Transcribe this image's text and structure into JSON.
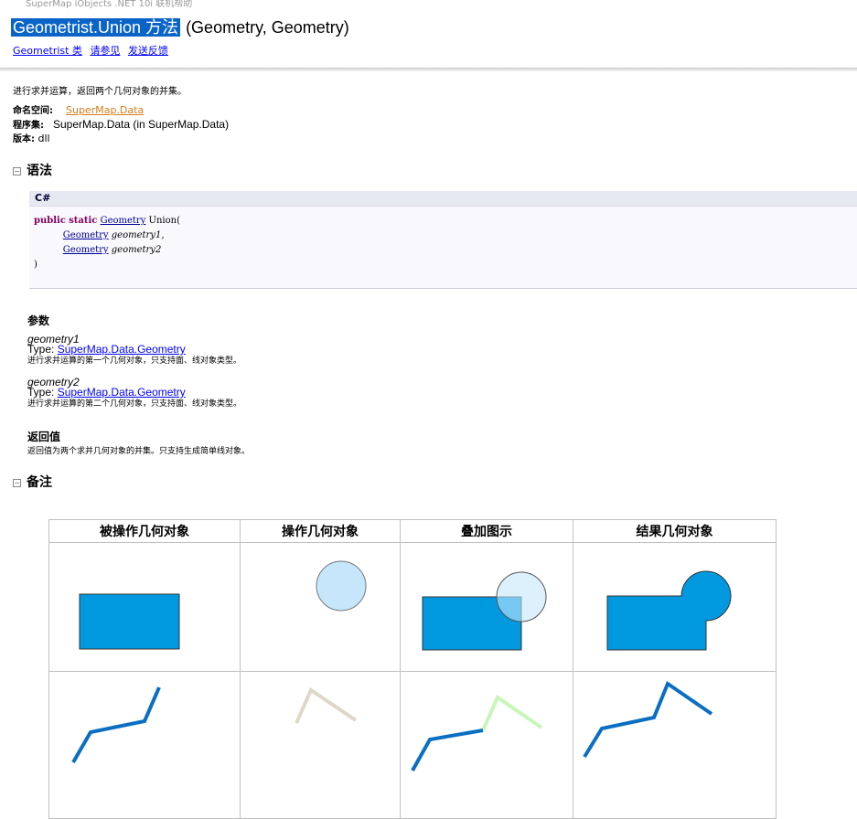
{
  "header": {
    "product": "SuperMap iObjects .NET 10i 联机帮助",
    "title_highlight": "Geometrist.Union 方法",
    "title_rest": "(Geometry, Geometry)",
    "links": [
      "Geometrist 类",
      "请参见",
      "发送反馈"
    ]
  },
  "summary": "进行求并运算，返回两个几何对象的并集。",
  "meta": {
    "namespace_label": "命名空间:",
    "namespace_value": "SuperMap.Data",
    "assembly_label": "程序集:",
    "assembly_value": "SuperMap.Data (in SuperMap.Data)",
    "version_label": "版本:",
    "version_value": "dll"
  },
  "sections": {
    "syntax": "语法",
    "remarks": "备注",
    "collapse_glyph": "−"
  },
  "code": {
    "lang": "C#",
    "kw1": "public",
    "kw2": "static",
    "ret_type": "Geometry",
    "method": "Union(",
    "p1_type": "Geometry",
    "p1_name": "geometry1,",
    "p2_type": "Geometry",
    "p2_name": "geometry2",
    "close": ")"
  },
  "params": {
    "heading": "参数",
    "items": [
      {
        "name": "geometry1",
        "type_label": "Type:",
        "type_link": "SuperMap.Data.Geometry",
        "desc": "进行求并运算的第一个几何对象，只支持面、线对象类型。"
      },
      {
        "name": "geometry2",
        "type_label": "Type:",
        "type_link": "SuperMap.Data.Geometry",
        "desc": "进行求并运算的第二个几何对象，只支持面、线对象类型。"
      }
    ]
  },
  "returns": {
    "heading": "返回值",
    "desc": "返回值为两个求并几何对象的并集。只支持生成简单线对象。"
  },
  "table": {
    "headers": [
      "被操作几何对象",
      "操作几何对象",
      "叠加图示",
      "结果几何对象"
    ]
  },
  "colors": {
    "fill_blue": "#0099e0",
    "light_blue": "#c6e7fb",
    "line_blue": "#0a6fc2",
    "line_beige": "#ddd8c8",
    "line_green": "#c8f5b8",
    "title_highlight": "#0a64c8"
  }
}
